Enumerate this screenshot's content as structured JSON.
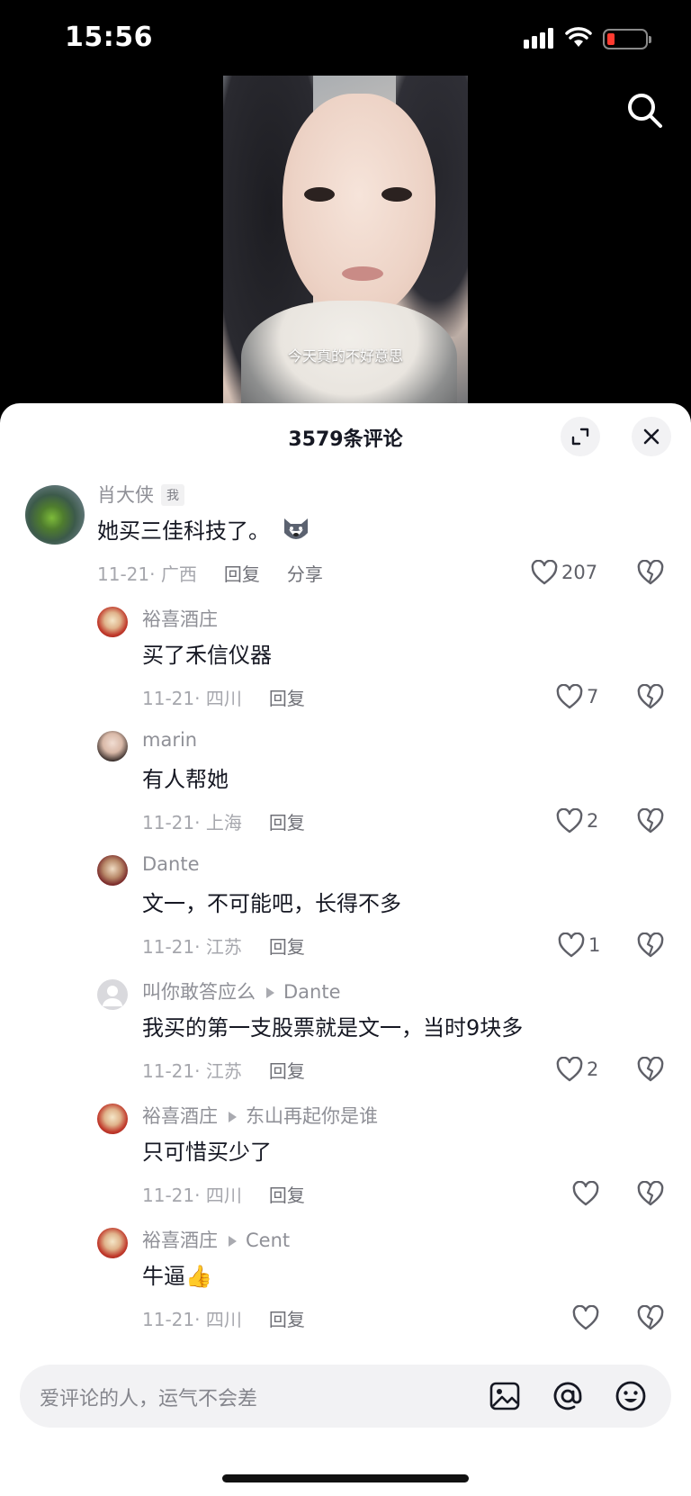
{
  "status_bar": {
    "time": "15:56",
    "battery_color": "#ff3b30"
  },
  "video": {
    "caption": "今天真的不好意思"
  },
  "icons": {
    "search": "search-icon",
    "expand": "expand-icon",
    "close": "close-icon",
    "like": "heart-icon",
    "dislike": "broken-heart-icon",
    "image": "image-icon",
    "mention": "at-icon",
    "emoji": "emoji-icon"
  },
  "sheet": {
    "title": "3579条评论"
  },
  "comments": [
    {
      "name": "肖大侠",
      "badge": "我",
      "reply_to": "",
      "text": "她买三佳科技了。",
      "date": "11-21· 广西",
      "reply_label": "回复",
      "share_label": "分享",
      "likes": "207"
    },
    {
      "name": "裕喜酒庄",
      "badge": "",
      "reply_to": "",
      "text": "买了禾信仪器",
      "date": "11-21· 四川",
      "reply_label": "回复",
      "share_label": "",
      "likes": "7"
    },
    {
      "name": "marin",
      "badge": "",
      "reply_to": "",
      "text": "有人帮她",
      "date": "11-21· 上海",
      "reply_label": "回复",
      "share_label": "",
      "likes": "2"
    },
    {
      "name": "Dante",
      "badge": "",
      "reply_to": "",
      "text": "文一，不可能吧，长得不多",
      "date": "11-21· 江苏",
      "reply_label": "回复",
      "share_label": "",
      "likes": "1"
    },
    {
      "name": "叫你敢答应么",
      "badge": "",
      "reply_to": "Dante",
      "text": "我买的第一支股票就是文一，当时9块多",
      "date": "11-21· 江苏",
      "reply_label": "回复",
      "share_label": "",
      "likes": "2"
    },
    {
      "name": "裕喜酒庄",
      "badge": "",
      "reply_to": "东山再起你是谁",
      "text": "只可惜买少了",
      "date": "11-21· 四川",
      "reply_label": "回复",
      "share_label": "",
      "likes": ""
    },
    {
      "name": "裕喜酒庄",
      "badge": "",
      "reply_to": "Cent",
      "text": "牛逼👍",
      "date": "11-21· 四川",
      "reply_label": "回复",
      "share_label": "",
      "likes": ""
    }
  ],
  "input": {
    "placeholder": "爱评论的人，运气不会差"
  }
}
